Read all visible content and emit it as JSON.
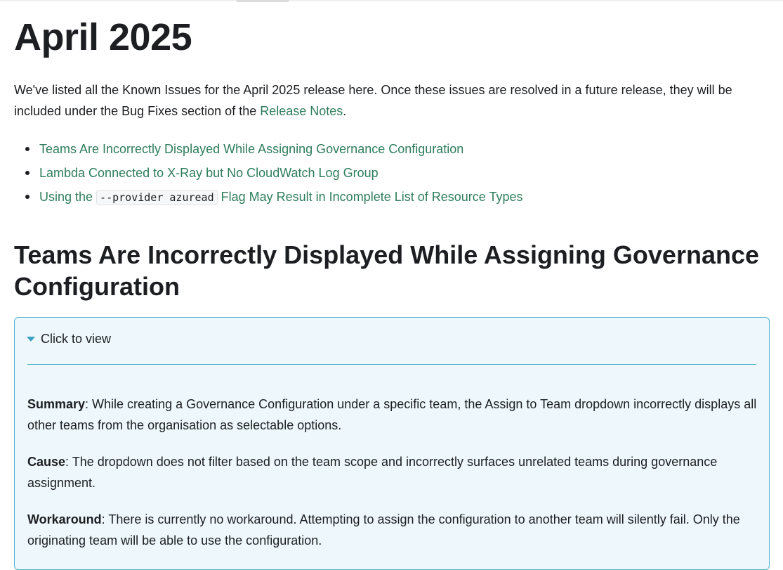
{
  "page_title": "April 2025",
  "intro": {
    "text_before": "We've listed all the Known Issues for the April 2025 release here. Once these issues are resolved in a future release, they will be included under the Bug Fixes section of the ",
    "link": "Release Notes",
    "text_after": "."
  },
  "issues": [
    {
      "label": "Teams Are Incorrectly Displayed While Assigning Governance Configuration"
    },
    {
      "label": "Lambda Connected to X-Ray but No CloudWatch Log Group"
    },
    {
      "prefix": "Using the ",
      "code": "--provider azuread",
      "suffix": " Flag May Result in Incomplete List of Resource Types"
    }
  ],
  "section": {
    "title": "Teams Are Incorrectly Displayed While Assigning Governance Configuration",
    "details_toggle": "Click to view",
    "summary_label": "Summary",
    "summary_text": ": While creating a Governance Configuration under a specific team, the Assign to Team dropdown incorrectly displays all other teams from the organisation as selectable options.",
    "cause_label": "Cause",
    "cause_text": ": The dropdown does not filter based on the team scope and incorrectly surfaces unrelated teams during governance assignment.",
    "workaround_label": "Workaround",
    "workaround_text": ": There is currently no workaround. Attempting to assign the configuration to another team will silently fail. Only the originating team will be able to use the configuration."
  },
  "colors": {
    "link": "#2e7d5b",
    "details_border": "#4fb3c9",
    "details_bg": "#eef8fc"
  }
}
